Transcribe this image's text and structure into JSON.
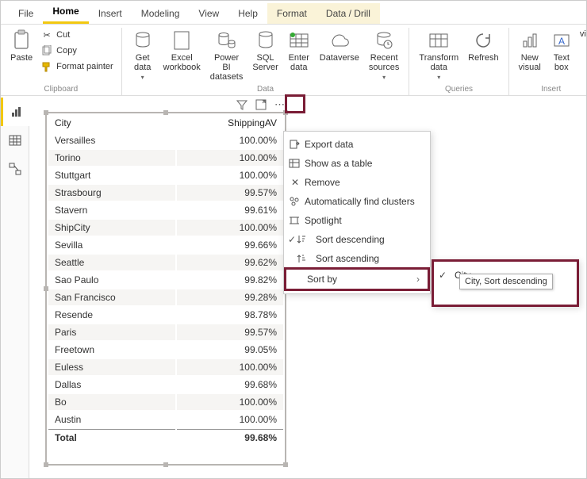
{
  "tabs": [
    "File",
    "Home",
    "Insert",
    "Modeling",
    "View",
    "Help",
    "Format",
    "Data / Drill"
  ],
  "clipboard": {
    "label": "Clipboard",
    "paste": "Paste",
    "cut": "Cut",
    "copy": "Copy",
    "formatPainter": "Format painter"
  },
  "data_group": {
    "label": "Data",
    "getData": "Get\ndata",
    "excel": "Excel\nworkbook",
    "pbi": "Power BI\ndatasets",
    "sql": "SQL\nServer",
    "enter": "Enter\ndata",
    "dataverse": "Dataverse",
    "recent": "Recent\nsources"
  },
  "queries": {
    "label": "Queries",
    "transform": "Transform\ndata",
    "refresh": "Refresh"
  },
  "insert_group": {
    "label": "Insert",
    "new": "New\nvisual",
    "text": "Text\nbox",
    "vi": "vi"
  },
  "table": {
    "headers": [
      "City",
      "ShippingAV"
    ],
    "rows": [
      [
        "Versailles",
        "100.00%"
      ],
      [
        "Torino",
        "100.00%"
      ],
      [
        "Stuttgart",
        "100.00%"
      ],
      [
        "Strasbourg",
        "99.57%"
      ],
      [
        "Stavern",
        "99.61%"
      ],
      [
        "ShipCity",
        "100.00%"
      ],
      [
        "Sevilla",
        "99.66%"
      ],
      [
        "Seattle",
        "99.62%"
      ],
      [
        "Sao Paulo",
        "99.82%"
      ],
      [
        "San Francisco",
        "99.28%"
      ],
      [
        "Resende",
        "98.78%"
      ],
      [
        "Paris",
        "99.57%"
      ],
      [
        "Freetown",
        "99.05%"
      ],
      [
        "Euless",
        "100.00%"
      ],
      [
        "Dallas",
        "99.68%"
      ],
      [
        "Bo",
        "100.00%"
      ],
      [
        "Austin",
        "100.00%"
      ]
    ],
    "total": [
      "Total",
      "99.68%"
    ]
  },
  "menu": {
    "export": "Export data",
    "showTable": "Show as a table",
    "remove": "Remove",
    "clusters": "Automatically find clusters",
    "spotlight": "Spotlight",
    "sortDesc": "Sort descending",
    "sortAsc": "Sort ascending",
    "sortBy": "Sort by"
  },
  "submenu": {
    "city": "City"
  },
  "tooltip": "City, Sort descending"
}
